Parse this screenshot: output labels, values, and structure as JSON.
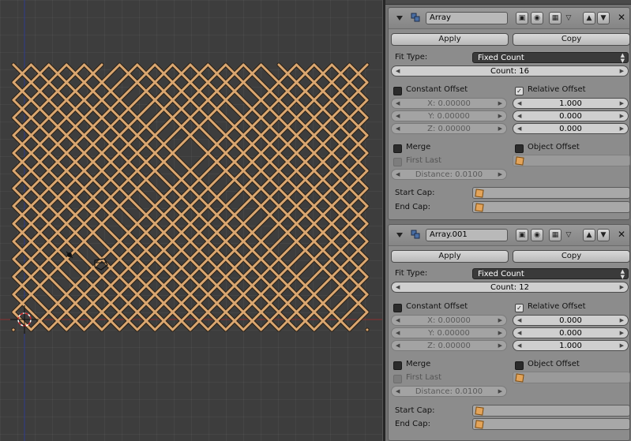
{
  "viewport": {
    "lattice_color": "#d9a670",
    "lattice_outline": "#2a2015",
    "axis_x_color": "#8a3030",
    "axis_y_color": "#303a8a"
  },
  "modifiers": [
    {
      "name": "Array",
      "apply_label": "Apply",
      "copy_label": "Copy",
      "fit_type_label": "Fit Type:",
      "fit_type_value": "Fixed Count",
      "count_text": "Count: 16",
      "constant_offset_label": "Constant Offset",
      "relative_offset_label": "Relative Offset",
      "constant_x": "X: 0.00000",
      "constant_y": "Y: 0.00000",
      "constant_z": "Z: 0.00000",
      "relative_x": "1.000",
      "relative_y": "0.000",
      "relative_z": "0.000",
      "merge_label": "Merge",
      "first_last_label": "First Last",
      "distance_text": "Distance: 0.0100",
      "object_offset_label": "Object Offset",
      "start_cap_label": "Start Cap:",
      "end_cap_label": "End Cap:"
    },
    {
      "name": "Array.001",
      "apply_label": "Apply",
      "copy_label": "Copy",
      "fit_type_label": "Fit Type:",
      "fit_type_value": "Fixed Count",
      "count_text": "Count: 12",
      "constant_offset_label": "Constant Offset",
      "relative_offset_label": "Relative Offset",
      "constant_x": "X: 0.00000",
      "constant_y": "Y: 0.00000",
      "constant_z": "Z: 0.00000",
      "relative_x": "0.000",
      "relative_y": "0.000",
      "relative_z": "1.000",
      "merge_label": "Merge",
      "first_last_label": "First Last",
      "distance_text": "Distance: 0.0100",
      "object_offset_label": "Object Offset",
      "start_cap_label": "Start Cap:",
      "end_cap_label": "End Cap:"
    }
  ]
}
